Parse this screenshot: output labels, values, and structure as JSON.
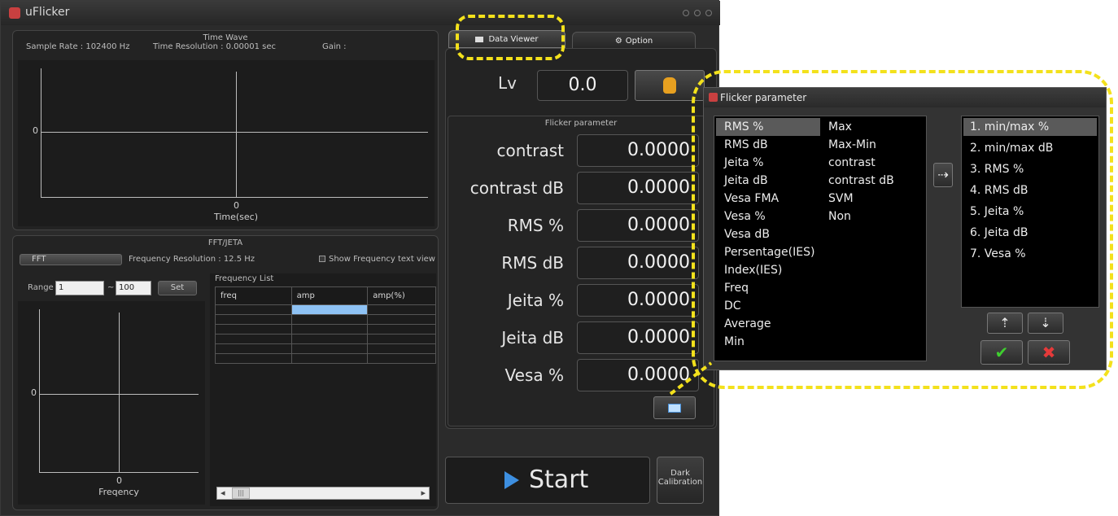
{
  "app": {
    "title": "uFlicker"
  },
  "time_wave": {
    "title": "Time Wave",
    "sample_rate": "Sample Rate : 102400 Hz",
    "time_resolution": "Time Resolution : 0.00001 sec",
    "gain": "Gain :",
    "y_tick": "0",
    "x_tick": "0",
    "x_label": "Time(sec)"
  },
  "fft": {
    "title": "FFT/JETA",
    "button": "FFT",
    "frequency_resolution": "Frequency Resolution : 12.5 Hz",
    "show_text_view": "Show Frequency text view",
    "range_label": "Range",
    "range_from": "1",
    "range_sep": "~",
    "range_to": "100",
    "set_button": "Set",
    "y_tick": "0",
    "x_tick": "0",
    "x_label": "Freqency"
  },
  "frequency_list": {
    "title": "Frequency List",
    "columns": [
      "freq",
      "amp",
      "amp(%)"
    ],
    "scroll_left": "◂",
    "scroll_thumb": "|||",
    "scroll_right": "▸"
  },
  "tabs": {
    "data_viewer": "Data Viewer",
    "option": "Option"
  },
  "lv": {
    "label": "Lv",
    "value": "0.0"
  },
  "flicker_parameter": {
    "title": "Flicker parameter",
    "rows": [
      {
        "label": "contrast",
        "value": "0.0000"
      },
      {
        "label": "contrast dB",
        "value": "0.0000"
      },
      {
        "label": "RMS %",
        "value": "0.0000"
      },
      {
        "label": "RMS dB",
        "value": "0.0000"
      },
      {
        "label": "Jeita %",
        "value": "0.0000"
      },
      {
        "label": "Jeita dB",
        "value": "0.0000"
      },
      {
        "label": "Vesa %",
        "value": "0.0000"
      }
    ]
  },
  "start_button": "Start",
  "dark_calibration": {
    "line1": "Dark",
    "line2": "Calibration"
  },
  "dialog": {
    "title": "Flicker parameter",
    "available_col1": [
      "RMS %",
      "RMS dB",
      "Jeita %",
      "Jeita dB",
      "Vesa FMA",
      "Vesa %",
      "Vesa dB",
      "Persentage(IES)",
      "Index(IES)",
      "Freq",
      "DC",
      "Average",
      "Min"
    ],
    "available_col2": [
      "Max",
      "Max-Min",
      "contrast",
      "contrast dB",
      "SVM",
      "Non"
    ],
    "selected": [
      "1. min/max %",
      "2. min/max dB",
      "3. RMS %",
      "4. RMS dB",
      "5. Jeita %",
      "6. Jeita dB",
      "7. Vesa %"
    ],
    "add_arrow": "⇢",
    "up_arrow": "⇡",
    "down_arrow": "⇣",
    "ok": "✔",
    "cancel": "✖"
  },
  "colors": {
    "highlight": "#f3e11c",
    "ok_green": "#3fcf2f",
    "cancel_red": "#e53a3a",
    "selection_blue": "#8ec2f4"
  }
}
